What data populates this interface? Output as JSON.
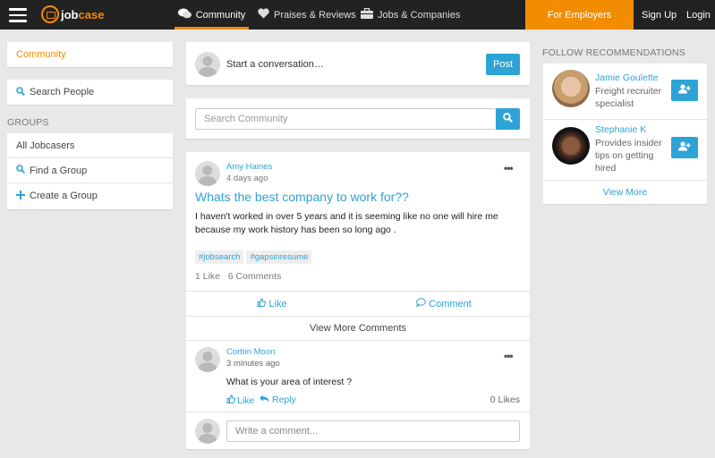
{
  "header": {
    "logo_text_a": "job",
    "logo_text_b": "case",
    "nav": [
      {
        "label": "Community",
        "icon": "comments-icon",
        "active": true
      },
      {
        "label": "Praises & Reviews",
        "icon": "heart-icon"
      },
      {
        "label": "Jobs & Companies",
        "icon": "briefcase-icon"
      }
    ],
    "employers_label": "For Employers",
    "signup_label": "Sign Up",
    "login_label": "Login"
  },
  "sidebar": {
    "community_label": "Community",
    "search_people_label": "Search People",
    "groups_heading": "GROUPS",
    "groups": [
      {
        "label": "All Jobcasers",
        "icon": ""
      },
      {
        "label": "Find a Group",
        "icon": "search-icon"
      },
      {
        "label": "Create a Group",
        "icon": "plus-icon"
      }
    ]
  },
  "composer": {
    "placeholder": "Start a conversation…",
    "post_label": "Post"
  },
  "search": {
    "placeholder": "Search Community"
  },
  "post": {
    "author": "Amy Haines",
    "time": "4 days ago",
    "title": "Whats the best company to work for??",
    "body": "I haven't worked in over 5 years and it is seeming like no one will hire me because my work history has been so long ago .",
    "tags": [
      "#jobsearch",
      "#gapsinresume"
    ],
    "likes_text": "1 Like",
    "comments_text": "6 Comments",
    "like_label": "Like",
    "comment_label": "Comment",
    "view_more_label": "View More Comments",
    "more_label": "•••"
  },
  "comment": {
    "author": "Corbin Moon",
    "time": "3 minutes ago",
    "text": "What is your area of interest ?",
    "like_label": "Like",
    "reply_label": "Reply",
    "likes_count": "0 Likes",
    "more_label": "•••"
  },
  "comment_input": {
    "placeholder": "Write a comment..."
  },
  "recommendations": {
    "heading": "FOLLOW RECOMMENDATIONS",
    "people": [
      {
        "name": "Jamie Goulette",
        "desc": "Freight recruiter specialist"
      },
      {
        "name": "Stephanie K",
        "desc": "Provides insider tips on getting hired"
      }
    ],
    "view_more_label": "View More"
  },
  "colors": {
    "accent": "#2ea3d5",
    "brand": "#f28c00",
    "topbar": "#222222"
  }
}
